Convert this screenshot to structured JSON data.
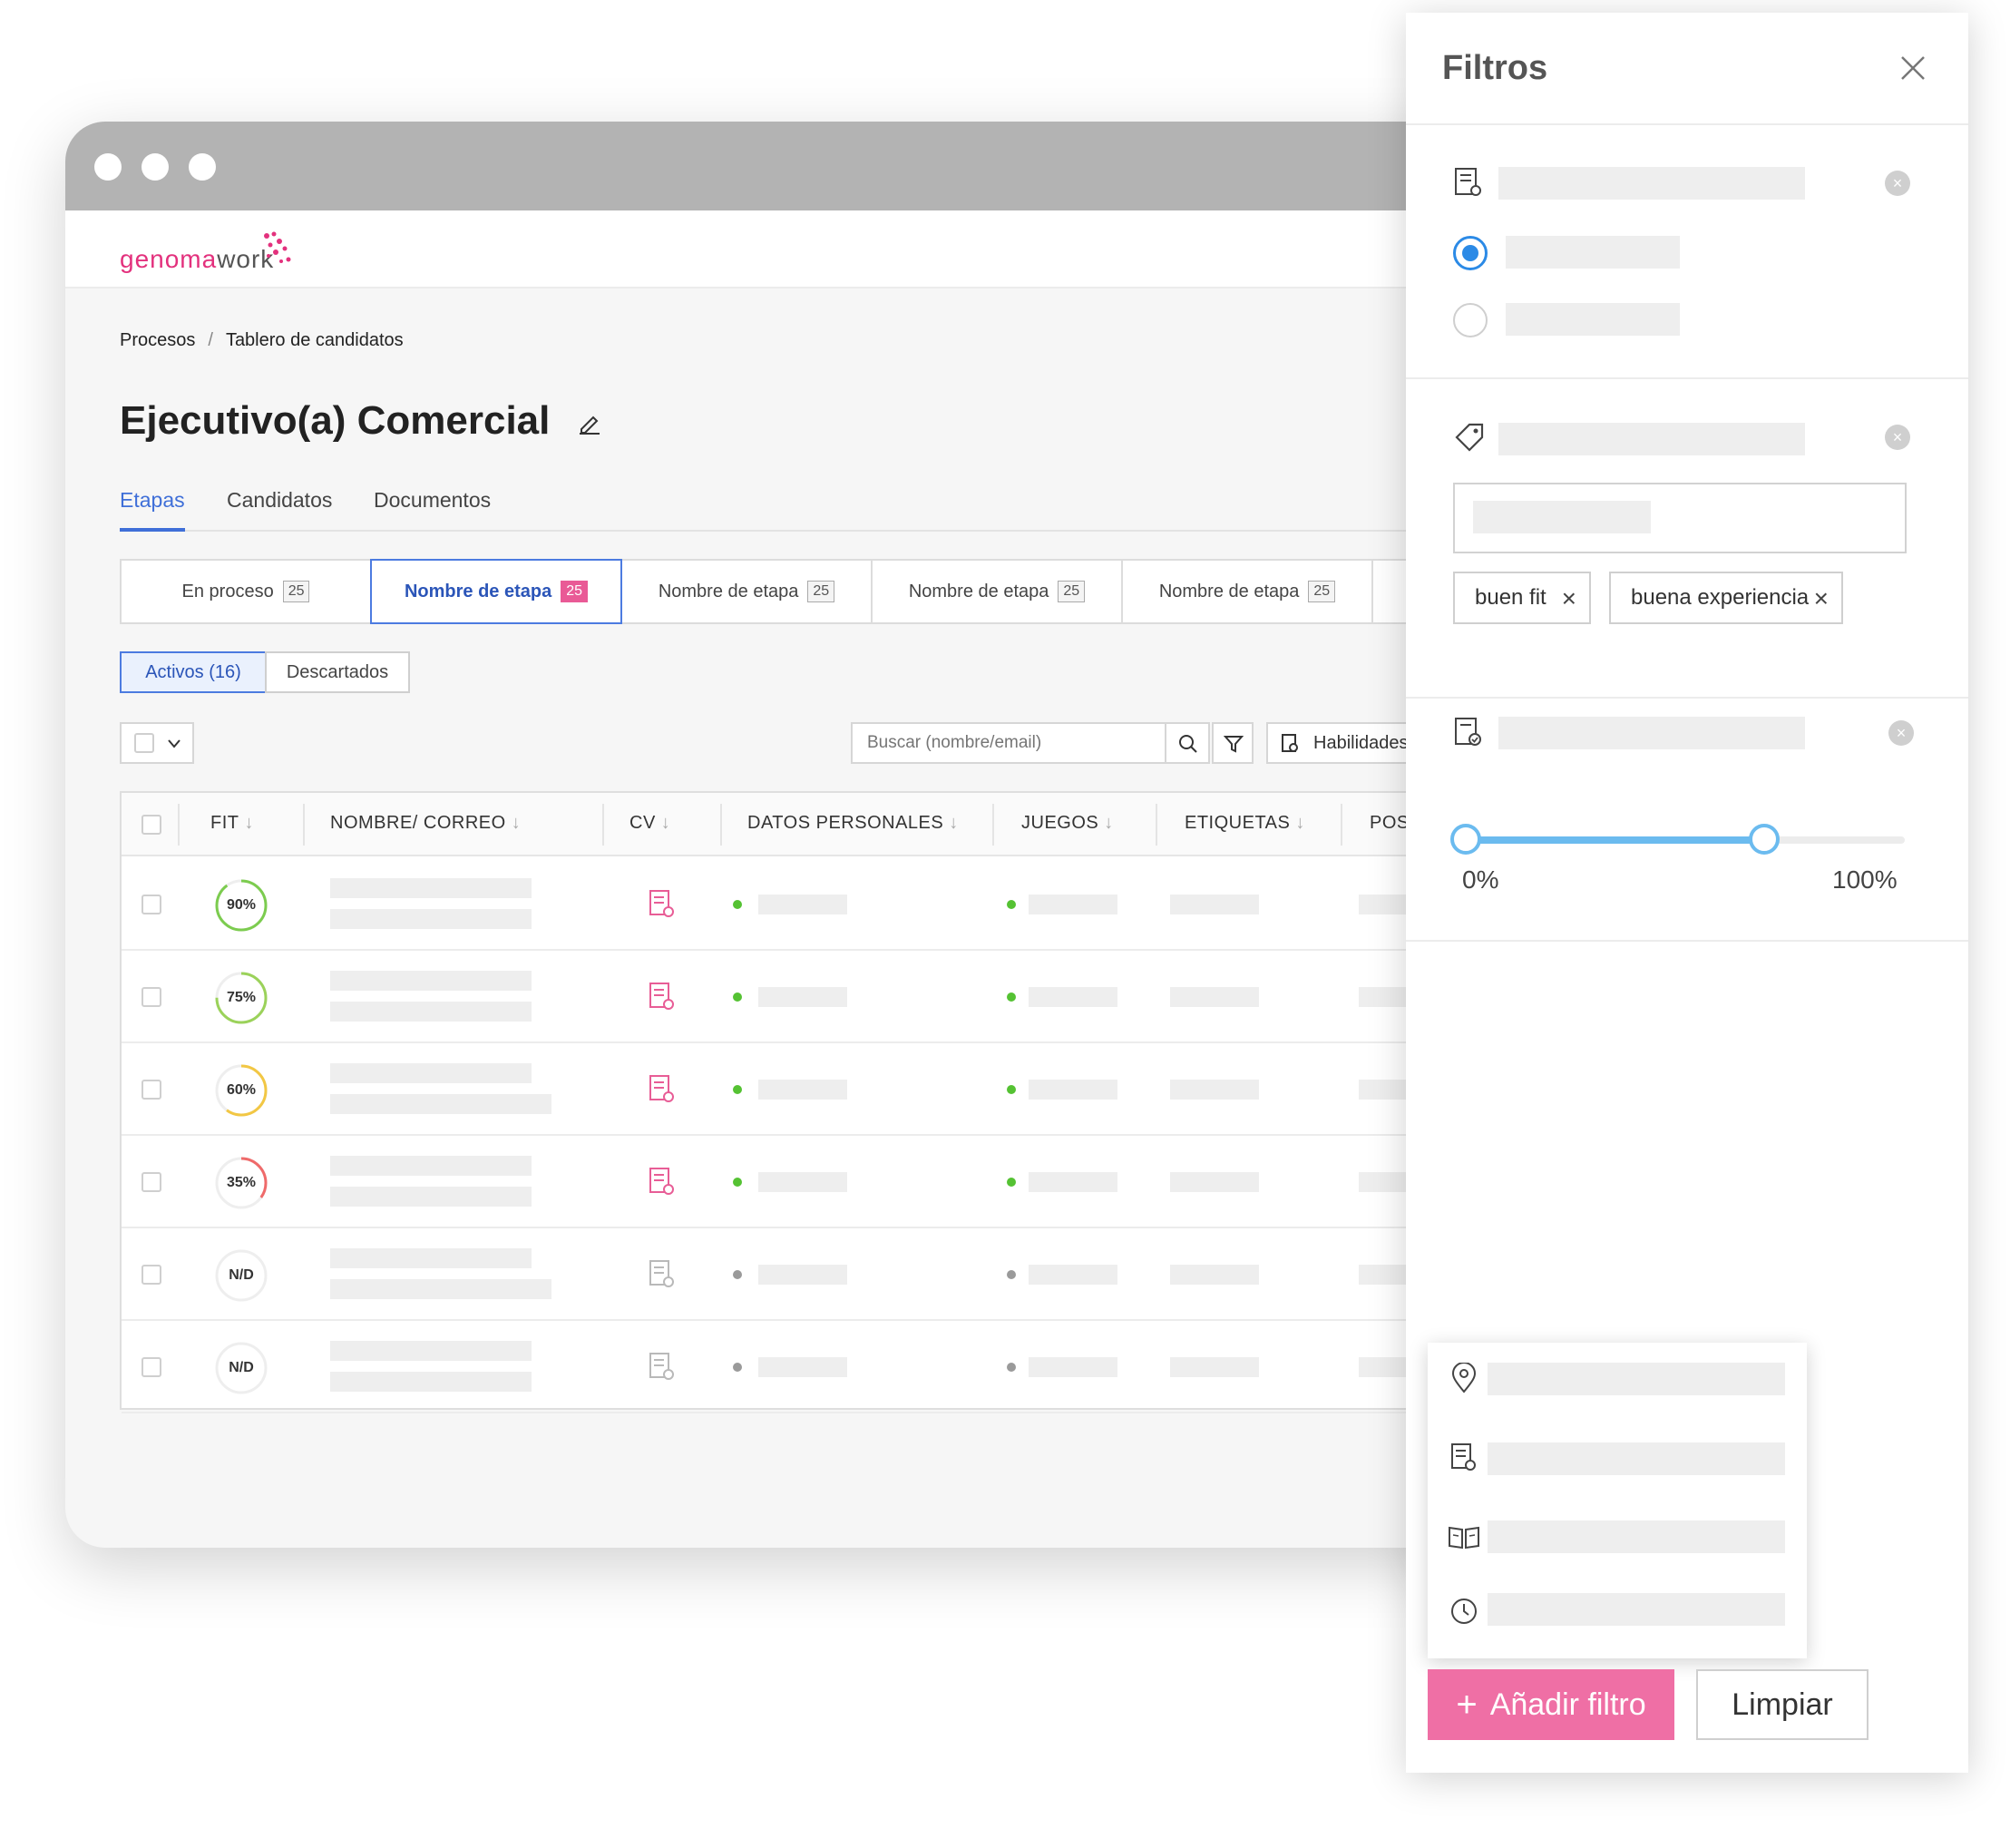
{
  "app": {
    "logo_left": "genoma",
    "logo_right": "work"
  },
  "breadcrumb": {
    "root": "Procesos",
    "separator": "/",
    "current": "Tablero de candidatos"
  },
  "page_title": "Ejecutivo(a) Comercial",
  "tabs": [
    {
      "label": "Etapas",
      "active": true
    },
    {
      "label": "Candidatos",
      "active": false
    },
    {
      "label": "Documentos",
      "active": false
    }
  ],
  "stages": [
    {
      "label": "En proceso",
      "count": "25"
    },
    {
      "label": "Nombre de etapa",
      "count": "25",
      "selected": true
    },
    {
      "label": "Nombre de etapa",
      "count": "25"
    },
    {
      "label": "Nombre de etapa",
      "count": "25"
    },
    {
      "label": "Nombre de etapa",
      "count": "25"
    }
  ],
  "segments": {
    "active": "Activos (16)",
    "discarded": "Descartados"
  },
  "toolbar": {
    "search_placeholder": "Buscar (nombre/email)",
    "skills_label": "Habilidades"
  },
  "table": {
    "columns": [
      "FIT",
      "NOMBRE/ CORREO",
      "CV",
      "DATOS PERSONALES",
      "JUEGOS",
      "ETIQUETAS",
      "POS"
    ],
    "rows": [
      {
        "fit": "90%",
        "fit_value": 0.9,
        "ring_color": "#7ccc4f",
        "status": "active"
      },
      {
        "fit": "75%",
        "fit_value": 0.75,
        "ring_color": "#9bd25a",
        "status": "active"
      },
      {
        "fit": "60%",
        "fit_value": 0.6,
        "ring_color": "#f2c744",
        "status": "active"
      },
      {
        "fit": "35%",
        "fit_value": 0.35,
        "ring_color": "#ef6a6a",
        "status": "active"
      },
      {
        "fit": "N/D",
        "fit_value": 0,
        "ring_color": "#dddddd",
        "status": "inactive"
      },
      {
        "fit": "N/D",
        "fit_value": 0,
        "ring_color": "#dddddd",
        "status": "inactive"
      }
    ]
  },
  "filters": {
    "title": "Filtros",
    "tags": [
      "buen fit",
      "buena experiencia"
    ],
    "range": {
      "min_label": "0%",
      "max_label": "100%",
      "low": 0,
      "high": 0.68
    },
    "add_button": "Añadir filtro",
    "clear_button": "Limpiar"
  },
  "colors": {
    "accent": "#3f6fd8",
    "brand": "#e3317d",
    "pink_button": "#ef6fa5",
    "slider": "#6bbbef",
    "green": "#55c233",
    "gray_dot": "#9a9a9a"
  }
}
